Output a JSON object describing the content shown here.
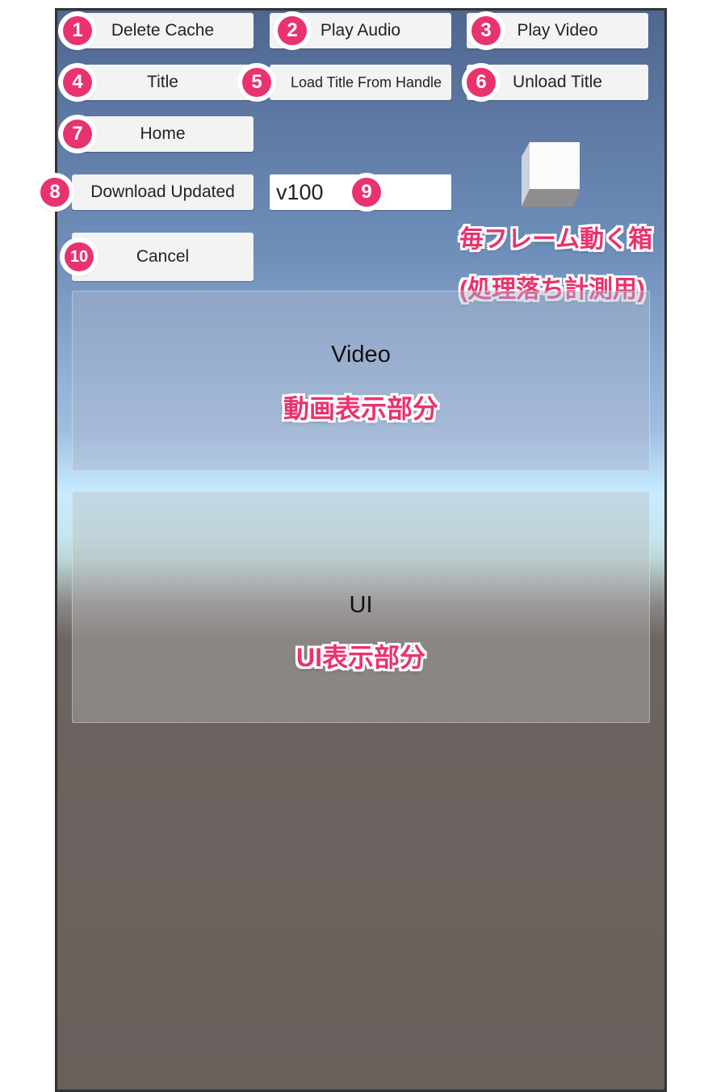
{
  "buttons": {
    "delete_cache": "Delete Cache",
    "play_audio": "Play Audio",
    "play_video": "Play Video",
    "title": "Title",
    "load_title_from_handle": "Load Title From Handle",
    "unload_title": "Unload Title",
    "home": "Home",
    "download_updated": "Download Updated",
    "cancel": "Cancel"
  },
  "version_input": {
    "value": "v100"
  },
  "badges": [
    "1",
    "2",
    "3",
    "4",
    "5",
    "6",
    "7",
    "8",
    "9",
    "10"
  ],
  "panels": {
    "video": {
      "title": "Video",
      "annotation": "動画表示部分"
    },
    "ui": {
      "title": "UI",
      "annotation": "UI表示部分"
    }
  },
  "cube_annotation": {
    "line1": "毎フレーム動く箱",
    "line2": "(処理落ち計測用)"
  },
  "colors": {
    "annotation": "#e8336e",
    "button_bg": "#f3f3f3",
    "frame_border": "#333333"
  }
}
